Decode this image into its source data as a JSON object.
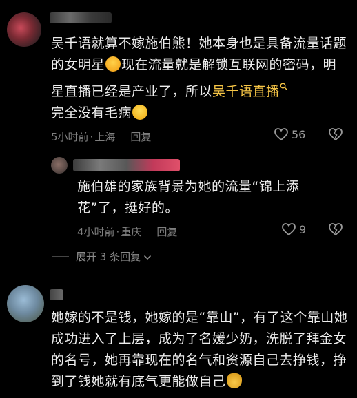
{
  "comments": [
    {
      "text_parts": [
        "吴千语就算不嫁施伯熊！她本身也是具备流量话题的女明星",
        "现在流量就是解锁互联网的密码，明星直播已经是产业了，所以",
        "吴千语直播",
        "完全没有毛病"
      ],
      "time": "5小时前",
      "location": "上海",
      "reply_label": "回复",
      "likes": "56",
      "icons": [
        "laughing-crying-emoji",
        "search-icon",
        "grinning-emoji",
        "heart-icon",
        "broken-heart-icon"
      ]
    },
    {
      "text_parts": [
        "施伯雄的家族背景为她的流量“锦上添花”了，挺好的。"
      ],
      "time": "4小时前",
      "location": "重庆",
      "reply_label": "回复",
      "likes": "9",
      "icons": [
        "heart-icon",
        "broken-heart-icon"
      ]
    },
    {
      "text_parts": [
        "她嫁的不是钱，她嫁的是“靠山”，有了这个靠山她成功进入了上层，成为了名媛少奶，洗脱了拜金女的名号，她再靠现在的名气和资源自己去挣钱，挣到了钱她就有底气更能做自己"
      ],
      "icons": [
        "money-bag-emoji"
      ]
    }
  ],
  "expand_label": "展开 3 条回复",
  "colors": {
    "link": "#f6c546",
    "background": "#000000",
    "meta": "#7f7f7f"
  }
}
